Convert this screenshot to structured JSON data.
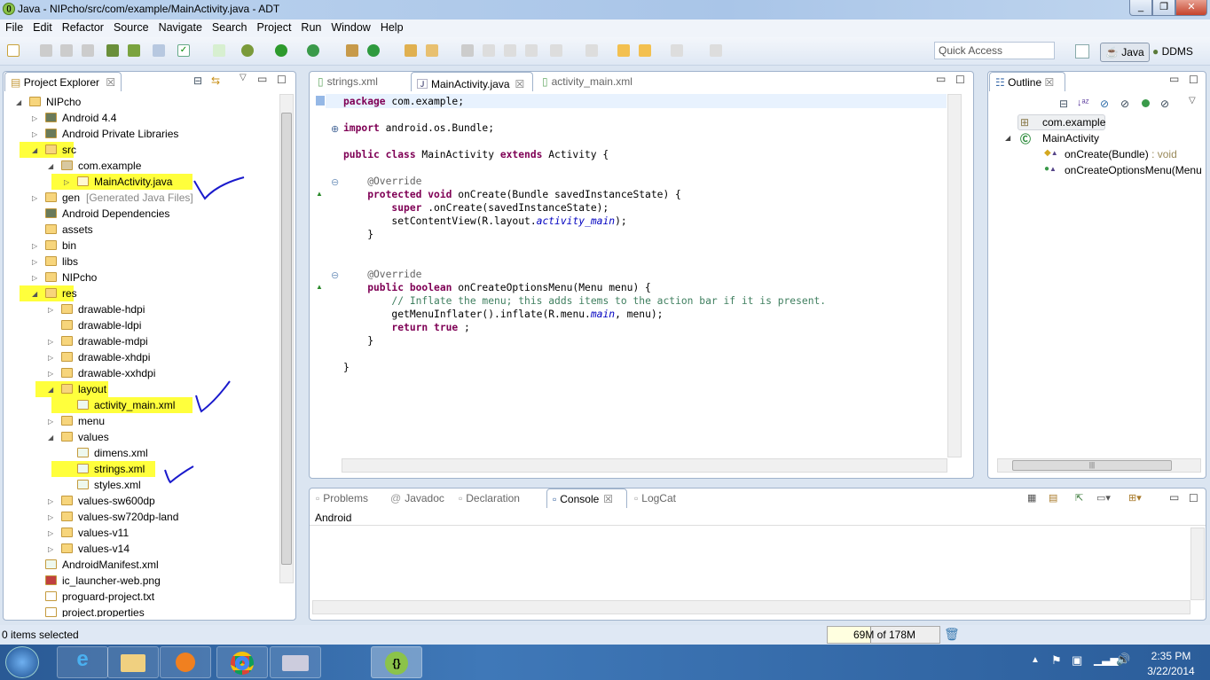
{
  "window": {
    "title": "Java - NIPcho/src/com/example/MainActivity.java - ADT",
    "app_icon": "adt-icon",
    "controls": [
      "minimize",
      "maximize",
      "close"
    ]
  },
  "menu": [
    "File",
    "Edit",
    "Refactor",
    "Source",
    "Navigate",
    "Search",
    "Project",
    "Run",
    "Window",
    "Help"
  ],
  "toolbar": {
    "quick_access_placeholder": "Quick Access",
    "perspectives": [
      {
        "label": "Java",
        "active": true
      },
      {
        "label": "DDMS",
        "active": false
      }
    ]
  },
  "project_explorer": {
    "title": "Project Explorer",
    "items": [
      {
        "label": "NIPcho",
        "level": 0,
        "state": "expanded",
        "icon": "project-icon"
      },
      {
        "label": "Android 4.4",
        "level": 1,
        "state": "collapsed",
        "icon": "library-icon"
      },
      {
        "label": "Android Private Libraries",
        "level": 1,
        "state": "collapsed",
        "icon": "library-icon"
      },
      {
        "label": "src",
        "level": 1,
        "state": "expanded",
        "icon": "source-folder-icon",
        "highlighted": true
      },
      {
        "label": "com.example",
        "level": 2,
        "state": "expanded",
        "icon": "package-icon"
      },
      {
        "label": "MainActivity.java",
        "level": 3,
        "state": "collapsed",
        "icon": "java-file-icon",
        "highlighted": true,
        "checked": true
      },
      {
        "label": "gen",
        "suffix": "[Generated Java Files]",
        "level": 1,
        "state": "collapsed",
        "icon": "source-folder-icon"
      },
      {
        "label": "Android Dependencies",
        "level": 1,
        "state": "none",
        "icon": "library-icon"
      },
      {
        "label": "assets",
        "level": 1,
        "state": "none",
        "icon": "folder-icon"
      },
      {
        "label": "bin",
        "level": 1,
        "state": "collapsed",
        "icon": "folder-icon"
      },
      {
        "label": "libs",
        "level": 1,
        "state": "collapsed",
        "icon": "folder-icon"
      },
      {
        "label": "NIPcho",
        "level": 1,
        "state": "collapsed",
        "icon": "folder-icon"
      },
      {
        "label": "res",
        "level": 1,
        "state": "expanded",
        "icon": "folder-icon",
        "highlighted": true
      },
      {
        "label": "drawable-hdpi",
        "level": 2,
        "state": "collapsed",
        "icon": "folder-icon"
      },
      {
        "label": "drawable-ldpi",
        "level": 2,
        "state": "none",
        "icon": "folder-icon"
      },
      {
        "label": "drawable-mdpi",
        "level": 2,
        "state": "collapsed",
        "icon": "folder-icon"
      },
      {
        "label": "drawable-xhdpi",
        "level": 2,
        "state": "collapsed",
        "icon": "folder-icon"
      },
      {
        "label": "drawable-xxhdpi",
        "level": 2,
        "state": "collapsed",
        "icon": "folder-icon"
      },
      {
        "label": "layout",
        "level": 2,
        "state": "expanded",
        "icon": "folder-icon",
        "highlighted": true
      },
      {
        "label": "activity_main.xml",
        "level": 3,
        "state": "none",
        "icon": "xml-file-icon",
        "highlighted": true,
        "checked": true
      },
      {
        "label": "menu",
        "level": 2,
        "state": "collapsed",
        "icon": "folder-icon"
      },
      {
        "label": "values",
        "level": 2,
        "state": "expanded",
        "icon": "folder-icon"
      },
      {
        "label": "dimens.xml",
        "level": 3,
        "state": "none",
        "icon": "xml-file-icon"
      },
      {
        "label": "strings.xml",
        "level": 3,
        "state": "none",
        "icon": "xml-file-icon",
        "highlighted": true,
        "checked": true
      },
      {
        "label": "styles.xml",
        "level": 3,
        "state": "none",
        "icon": "xml-file-icon"
      },
      {
        "label": "values-sw600dp",
        "level": 2,
        "state": "collapsed",
        "icon": "folder-icon"
      },
      {
        "label": "values-sw720dp-land",
        "level": 2,
        "state": "collapsed",
        "icon": "folder-icon"
      },
      {
        "label": "values-v11",
        "level": 2,
        "state": "collapsed",
        "icon": "folder-icon"
      },
      {
        "label": "values-v14",
        "level": 2,
        "state": "collapsed",
        "icon": "folder-icon"
      },
      {
        "label": "AndroidManifest.xml",
        "level": 1,
        "state": "none",
        "icon": "xml-file-icon"
      },
      {
        "label": "ic_launcher-web.png",
        "level": 1,
        "state": "none",
        "icon": "image-file-icon"
      },
      {
        "label": "proguard-project.txt",
        "level": 1,
        "state": "none",
        "icon": "text-file-icon"
      },
      {
        "label": "project.properties",
        "level": 1,
        "state": "none",
        "icon": "text-file-icon"
      }
    ]
  },
  "editor": {
    "tabs": [
      {
        "label": "strings.xml",
        "active": false
      },
      {
        "label": "MainActivity.java",
        "active": true
      },
      {
        "label": "activity_main.xml",
        "active": false
      }
    ],
    "lines": [
      [
        [
          "kw",
          "package"
        ],
        [
          "",
          "com.example;"
        ]
      ],
      [],
      [
        [
          "kw",
          "import"
        ],
        [
          "",
          "android.os.Bundle;"
        ]
      ],
      [],
      [
        [
          "kw",
          "public class"
        ],
        [
          "",
          "MainActivity "
        ],
        [
          "kw",
          "extends"
        ],
        [
          "",
          "Activity {"
        ]
      ],
      [],
      [
        [
          "ann",
          "    @Override"
        ]
      ],
      [
        [
          "kw",
          "    protected void"
        ],
        [
          "",
          "onCreate(Bundle savedInstanceState) {"
        ]
      ],
      [
        [
          "kw",
          "        super"
        ],
        [
          "",
          ".onCreate(savedInstanceState);"
        ]
      ],
      [
        [
          "",
          "        setContentView(R.layout."
        ],
        [
          "fld",
          "activity_main"
        ],
        [
          "",
          ");"
        ]
      ],
      [
        [
          "",
          "    }"
        ]
      ],
      [],
      [],
      [
        [
          "ann",
          "    @Override"
        ]
      ],
      [
        [
          "kw",
          "    public boolean"
        ],
        [
          "",
          "onCreateOptionsMenu(Menu menu) {"
        ]
      ],
      [
        [
          "cm",
          "        // Inflate the menu; this adds items to the action bar if it is present."
        ]
      ],
      [
        [
          "",
          "        getMenuInflater().inflate(R.menu."
        ],
        [
          "fld",
          "main"
        ],
        [
          "",
          ", menu);"
        ]
      ],
      [
        [
          "kw",
          "        return true"
        ],
        [
          "",
          ";"
        ]
      ],
      [
        [
          "",
          "    }"
        ]
      ],
      [],
      [
        [
          "",
          "}"
        ]
      ]
    ]
  },
  "outline": {
    "title": "Outline",
    "items": [
      {
        "label": "com.example",
        "icon": "package-icon"
      },
      {
        "label": "MainActivity",
        "icon": "class-icon"
      },
      {
        "label": "onCreate(Bundle)",
        "type": " : void",
        "icon": "protected-method-icon"
      },
      {
        "label": "onCreateOptionsMenu(Menu",
        "icon": "public-method-icon"
      }
    ]
  },
  "bottom": {
    "tabs": [
      {
        "label": "Problems",
        "active": false
      },
      {
        "label": "Javadoc",
        "active": false
      },
      {
        "label": "Declaration",
        "active": false
      },
      {
        "label": "Console",
        "active": true
      },
      {
        "label": "LogCat",
        "active": false
      }
    ],
    "console_header": "Android"
  },
  "status": {
    "selection": "0 items selected",
    "heap": "69M of 178M",
    "heap_used_fraction": 0.39
  },
  "taskbar": {
    "time": "2:35 PM",
    "date": "3/22/2014"
  },
  "colors": {
    "highlight": "#ffff3c",
    "annotation_ink": "#1a1acc"
  }
}
